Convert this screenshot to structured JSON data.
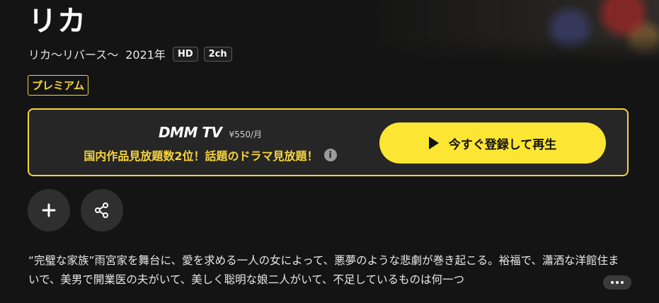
{
  "title": "リカ",
  "meta": {
    "subtitle": "リカ〜リバース〜",
    "year": "2021年",
    "badges": [
      "HD",
      "2ch"
    ]
  },
  "premium_badge": "プレミアム",
  "plan": {
    "brand": "DMM TV",
    "price": "¥550/月",
    "promo": "国内作品見放題数2位！話題のドラマ見放題！",
    "cta_label": "今すぐ登録して再生"
  },
  "description": "“完璧な家族”雨宮家を舞台に、愛を求める一人の女によって、悪夢のような悲劇が巻き起こる。裕福で、瀟洒な洋館住まいで、美男で開業医の夫がいて、美しく聡明な娘二人がいて、不足しているものは何一つ",
  "colors": {
    "accent": "#f6d43c",
    "cta": "#fde533",
    "background": "#141414",
    "panel": "#262626"
  },
  "icons": {
    "add": "plus-icon",
    "share": "share-icon",
    "info": "info-icon",
    "play": "play-icon",
    "more": "more-icon"
  }
}
